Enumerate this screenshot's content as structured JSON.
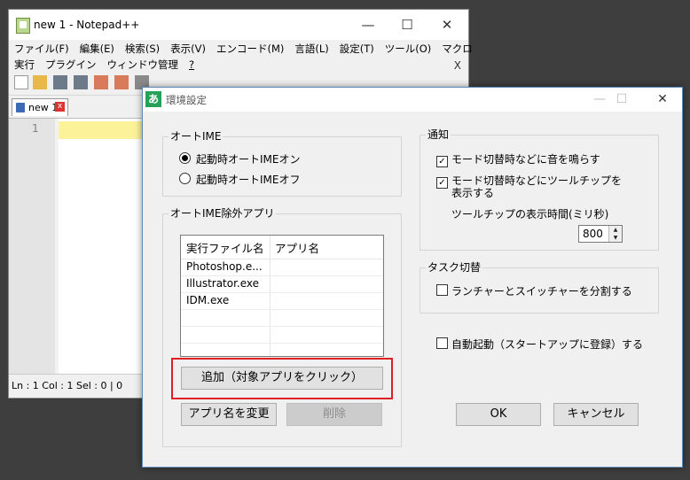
{
  "notepad": {
    "title": "new 1 - Notepad++",
    "menu_row1": [
      "ファイル(F)",
      "編集(E)",
      "検索(S)",
      "表示(V)",
      "エンコード(M)",
      "言語(L)",
      "設定(T)",
      "ツール(O)",
      "マクロ"
    ],
    "menu_row2": [
      "実行",
      "プラグイン",
      "ウィンドウ管理",
      "?"
    ],
    "menu_close": "X",
    "tab_label": "new 1",
    "tab_close": "x",
    "line_number": "1",
    "status": "Ln : 1    Col : 1    Sel : 0 | 0",
    "window_min": "—",
    "window_max": "☐",
    "window_close": "✕"
  },
  "dialog": {
    "icon_char": "あ",
    "title": "環境設定",
    "min": "—",
    "max": "☐",
    "close": "✕",
    "auto_ime": {
      "label": "オートIME",
      "option_on": "起動時オートIMEオン",
      "option_off": "起動時オートIMEオフ",
      "selected": "option_on"
    },
    "exclusions": {
      "label": "オートIME除外アプリ",
      "columns": [
        "実行ファイル名",
        "アプリ名"
      ],
      "rows": [
        {
          "exe": "Photoshop.e...",
          "app": ""
        },
        {
          "exe": "Illustrator.exe",
          "app": ""
        },
        {
          "exe": "IDM.exe",
          "app": ""
        },
        {
          "exe": "",
          "app": ""
        },
        {
          "exe": "",
          "app": ""
        },
        {
          "exe": "",
          "app": ""
        }
      ],
      "add_button": "追加（対象アプリをクリック）",
      "rename_button": "アプリ名を変更",
      "delete_button": "削除"
    },
    "notify": {
      "label": "通知",
      "sound_label": "モード切替時などに音を鳴らす",
      "sound_checked": true,
      "tooltip_label_line1": "モード切替時などにツールチップを",
      "tooltip_label_line2": "表示する",
      "tooltip_checked": true,
      "duration_label": "ツールチップの表示時間(ミリ秒)",
      "duration_value": "800"
    },
    "task_switch": {
      "label": "タスク切替",
      "split_label": "ランチャーとスイッチャーを分割する",
      "split_checked": false
    },
    "autostart": {
      "label": "自動起動（スタートアップに登録）する",
      "checked": false
    },
    "ok_button": "OK",
    "cancel_button": "キャンセル",
    "check_mark": "✓"
  },
  "colors": {
    "highlight": "#e01f25",
    "current_line": "#fbf29a",
    "ime_icon": "#25a25a"
  }
}
